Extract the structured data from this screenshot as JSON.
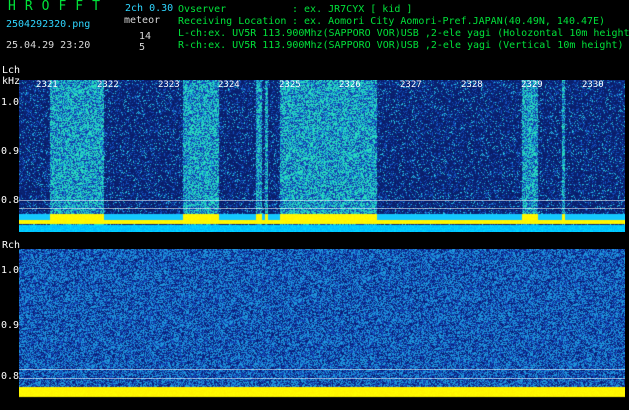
{
  "header": {
    "brand": "HROFFT",
    "version": "2ch 0.30",
    "filename": "2504292320.png",
    "mode": "meteor",
    "datetime": "25.04.29 23:20",
    "lch_count": "14",
    "rch_count": "5",
    "observer_label": "Ovserver",
    "observer_value": ": ex. JR7CYX [ kid ]",
    "location_label": "Receiving Location",
    "location_value": ": ex. Aomori City Aomori-Pref.JAPAN(40.49N, 140.47E)",
    "lch_info": "L-ch:ex. UV5R 113.900Mhz(SAPPORO VOR)USB ,2-ele yagi (Holozontal 10m height",
    "rch_info": "R-ch:ex. UV5R 113.900Mhz(SAPPORO VOR)USB ,2-ele yagi (Vertical 10m height)"
  },
  "lch": {
    "label": "Lch",
    "unit": "kHz",
    "y_ticks": [
      "1.0",
      "0.9",
      "0.8"
    ],
    "time_ticks": [
      "2321",
      "2322",
      "2323",
      "2324",
      "2325",
      "2326",
      "2327",
      "2328",
      "2329",
      "2330"
    ]
  },
  "rch": {
    "label": "Rch",
    "y_ticks": [
      "1.0",
      "0.9",
      "0.8"
    ]
  },
  "colors": {
    "background": "#000000",
    "label_green": "#00e23a",
    "label_cyan": "#2fd6ff",
    "noise_low": "#0a1a66",
    "noise_high": "#22ccb0",
    "carrier": "#ffff00"
  },
  "signal": {
    "lch_bursts_minutes": [
      [
        0.5,
        1.4
      ],
      [
        2.7,
        3.3
      ],
      [
        3.9,
        4.0
      ],
      [
        4.05,
        4.1
      ],
      [
        4.3,
        5.9
      ],
      [
        8.3,
        8.55
      ],
      [
        8.95,
        9.0
      ]
    ]
  }
}
